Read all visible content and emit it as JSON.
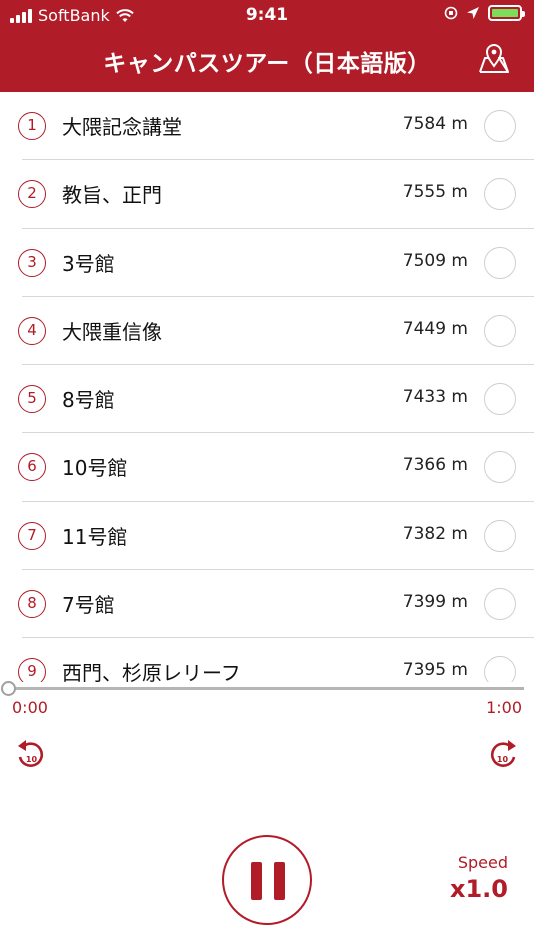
{
  "status_bar": {
    "carrier": "SoftBank",
    "time": "9:41"
  },
  "header": {
    "title": "キャンパスツアー（日本語版）",
    "map_icon": "map-pin-icon"
  },
  "tour_list": [
    {
      "number": "1",
      "name": "大隈記念講堂",
      "distance": "7584 m"
    },
    {
      "number": "2",
      "name": "教旨、正門",
      "distance": "7555 m"
    },
    {
      "number": "3",
      "name": "3号館",
      "distance": "7509 m"
    },
    {
      "number": "4",
      "name": "大隈重信像",
      "distance": "7449 m"
    },
    {
      "number": "5",
      "name": "8号館",
      "distance": "7433 m"
    },
    {
      "number": "6",
      "name": "10号館",
      "distance": "7366 m"
    },
    {
      "number": "7",
      "name": "11号館",
      "distance": "7382 m"
    },
    {
      "number": "8",
      "name": "7号館",
      "distance": "7399 m"
    },
    {
      "number": "9",
      "name": "西門、杉原レリーフ",
      "distance": "7395 m"
    }
  ],
  "player": {
    "current_time": "0:00",
    "total_time": "1:00",
    "progress": 0,
    "skip_back_label": "10",
    "skip_forward_label": "10",
    "speed_label": "Speed",
    "speed_value": "x1.0",
    "state": "playing"
  },
  "colors": {
    "brand": "#b01c27",
    "battery": "#7ddc5a"
  }
}
